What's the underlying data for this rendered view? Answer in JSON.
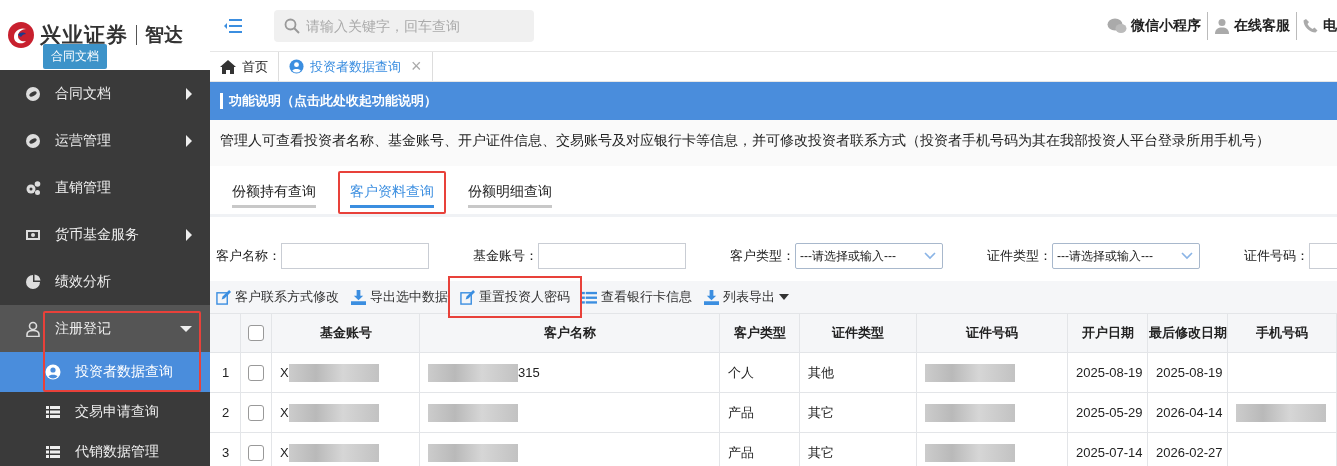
{
  "logo": {
    "name": "兴业证券",
    "product": "智达"
  },
  "tooltip": "合同文档",
  "sidebar": {
    "items": [
      {
        "label": "合同文档",
        "submenu": true,
        "expanded": false,
        "highlighted": false
      },
      {
        "label": "运营管理",
        "submenu": true,
        "expanded": false,
        "highlighted": false
      },
      {
        "label": "直销管理",
        "submenu": false,
        "expanded": false,
        "highlighted": false
      },
      {
        "label": "货币基金服务",
        "submenu": true,
        "expanded": false,
        "highlighted": false
      },
      {
        "label": "绩效分析",
        "submenu": false,
        "expanded": false,
        "highlighted": false
      },
      {
        "label": "注册登记",
        "submenu": true,
        "expanded": true,
        "highlighted": true,
        "children": [
          {
            "label": "投资者数据查询",
            "selected": true
          },
          {
            "label": "交易申请查询",
            "selected": false
          },
          {
            "label": "代销数据管理",
            "selected": false
          }
        ]
      }
    ]
  },
  "search": {
    "placeholder": "请输入关键字，回车查询"
  },
  "header_links": [
    {
      "label": "微信小程序"
    },
    {
      "label": "在线客服"
    },
    {
      "label": "电"
    }
  ],
  "page_tabs": [
    {
      "label": "首页",
      "selected": false
    },
    {
      "label": "投资者数据查询",
      "selected": true,
      "close": "×"
    }
  ],
  "info_bar": {
    "title": "功能说明（点击此处收起功能说明）",
    "description": "管理人可查看投资者名称、基金账号、开户证件信息、交易账号及对应银行卡等信息，并可修改投资者联系方式（投资者手机号码为其在我部投资人平台登录所用手机号）"
  },
  "query_tabs": [
    {
      "label": "份额持有查询",
      "selected": false,
      "highlighted": false
    },
    {
      "label": "客户资料查询",
      "selected": true,
      "highlighted": true
    },
    {
      "label": "份额明细查询",
      "selected": false,
      "highlighted": false
    }
  ],
  "filters": [
    {
      "label": "客户名称：",
      "kind": "text"
    },
    {
      "label": "基金账号：",
      "kind": "text"
    },
    {
      "label": "客户类型：",
      "kind": "select",
      "placeholder": "---请选择或输入---"
    },
    {
      "label": "证件类型：",
      "kind": "select",
      "placeholder": "---请选择或输入---"
    },
    {
      "label": "证件号码：",
      "kind": "text"
    }
  ],
  "toolbar": [
    {
      "label": "客户联系方式修改",
      "highlighted": false,
      "dropdown": false
    },
    {
      "label": "导出选中数据",
      "highlighted": false,
      "dropdown": false
    },
    {
      "label": "重置投资人密码",
      "highlighted": true,
      "dropdown": false
    },
    {
      "label": "查看银行卡信息",
      "highlighted": false,
      "dropdown": false
    },
    {
      "label": "列表导出",
      "highlighted": false,
      "dropdown": true
    }
  ],
  "table": {
    "all_checked": false,
    "columns": [
      "基金账号",
      "客户名称",
      "客户类型",
      "证件类型",
      "证件号码",
      "开户日期",
      "最后修改日期",
      "手机号码"
    ],
    "rows": [
      {
        "index": "1",
        "checked": false,
        "cells": [
          {
            "text": "X",
            "redacted": true
          },
          {
            "text": "315",
            "redacted": true
          },
          {
            "text": "个人"
          },
          {
            "text": "其他"
          },
          {
            "redacted": true
          },
          {
            "text": "2025-08-19"
          },
          {
            "text": "2025-08-19"
          },
          {}
        ]
      },
      {
        "index": "2",
        "checked": false,
        "cells": [
          {
            "text": "X",
            "redacted": true
          },
          {
            "redacted": true
          },
          {
            "text": "产品"
          },
          {
            "text": "其它"
          },
          {
            "redacted": true
          },
          {
            "text": "2025-05-29"
          },
          {
            "text": "2026-04-14"
          },
          {
            "redacted": true
          }
        ]
      },
      {
        "index": "3",
        "checked": false,
        "cells": [
          {
            "text": "X",
            "redacted": true
          },
          {
            "redacted": true
          },
          {
            "text": "产品"
          },
          {
            "text": "其它"
          },
          {
            "redacted": true
          },
          {
            "text": "2025-07-14"
          },
          {
            "text": "2026-02-27"
          },
          {}
        ]
      }
    ]
  }
}
